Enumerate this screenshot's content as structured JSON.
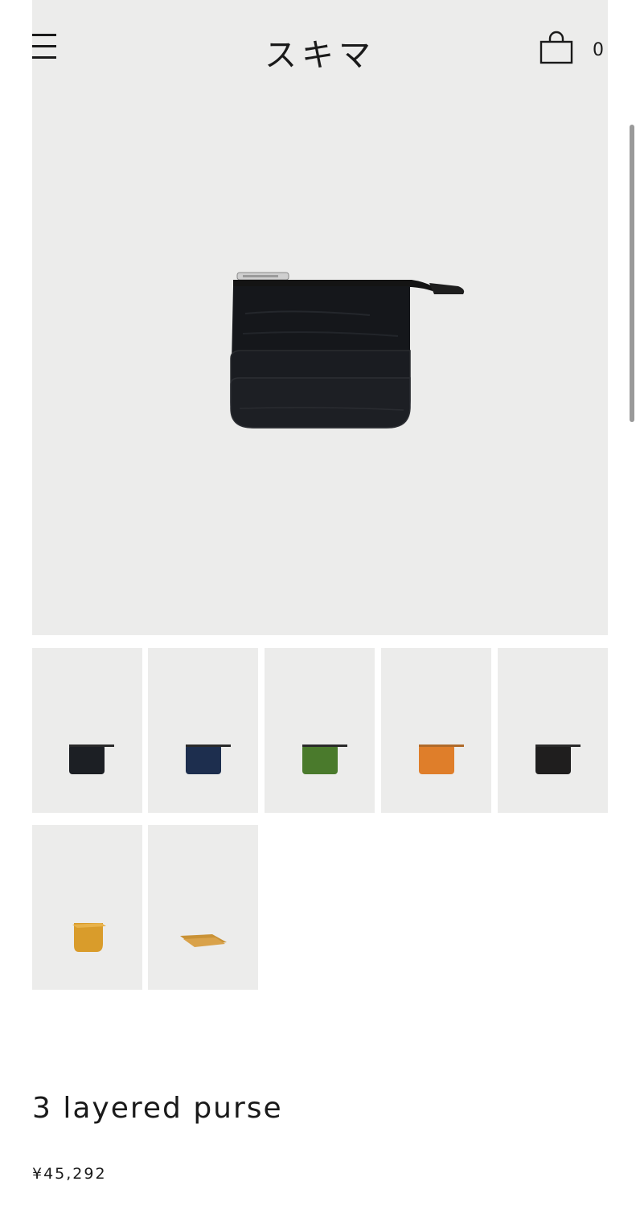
{
  "header": {
    "menu_icon": "hamburger-menu-icon",
    "logo_text": "スキマ",
    "cart_icon": "shopping-bag-icon",
    "cart_count": "0"
  },
  "gallery": {
    "background_color": "#ececeb",
    "thumbnails": [
      {
        "color_name": "black",
        "color": "#1c1f24"
      },
      {
        "color_name": "navy",
        "color": "#1d2e4e"
      },
      {
        "color_name": "green",
        "color": "#4a7a2c"
      },
      {
        "color_name": "orange",
        "color": "#df7e2a"
      },
      {
        "color_name": "dark",
        "color": "#1f1e1e"
      },
      {
        "color_name": "yellow-open",
        "color": "#d99c2b"
      },
      {
        "color_name": "yellow-side",
        "color": "#c99236"
      }
    ]
  },
  "product": {
    "title": "3 layered purse",
    "price": "¥45,292"
  }
}
